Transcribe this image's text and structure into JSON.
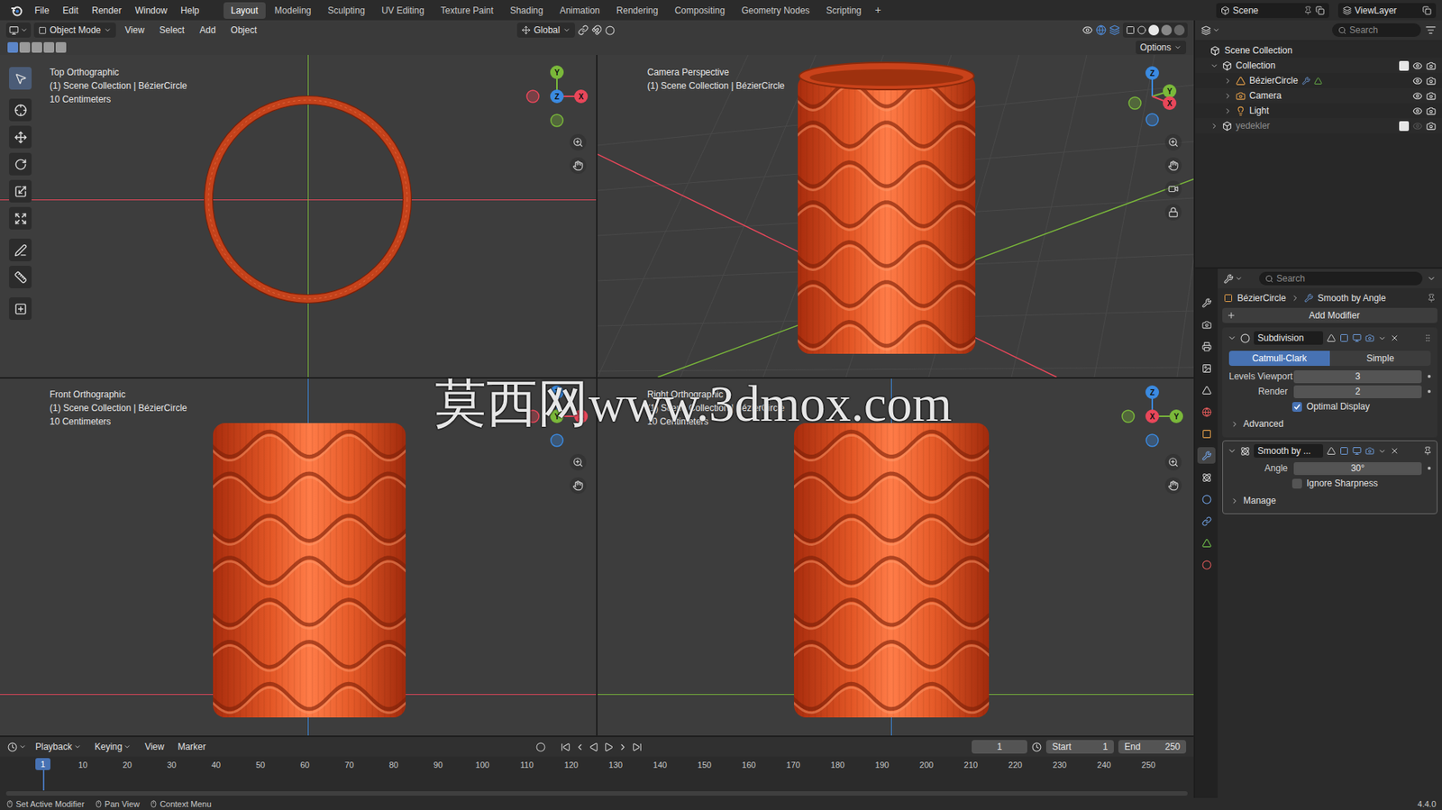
{
  "app": {
    "name": "Blender",
    "version": "4.4.0"
  },
  "menu_bar": {
    "items": [
      "File",
      "Edit",
      "Render",
      "Window",
      "Help"
    ]
  },
  "workspaces": [
    {
      "label": "Layout",
      "selected": true
    },
    {
      "label": "Modeling",
      "selected": false
    },
    {
      "label": "Sculpting",
      "selected": false
    },
    {
      "label": "UV Editing",
      "selected": false
    },
    {
      "label": "Texture Paint",
      "selected": false
    },
    {
      "label": "Shading",
      "selected": false
    },
    {
      "label": "Animation",
      "selected": false
    },
    {
      "label": "Rendering",
      "selected": false
    },
    {
      "label": "Compositing",
      "selected": false
    },
    {
      "label": "Geometry Nodes",
      "selected": false
    },
    {
      "label": "Scripting",
      "selected": false
    }
  ],
  "add_workspace": "+",
  "scene": "Scene",
  "view_layer": "ViewLayer",
  "viewport_header": {
    "mode": "Object Mode",
    "menus": [
      "View",
      "Select",
      "Add",
      "Object"
    ],
    "orientation": "Global",
    "options": "Options"
  },
  "toolbar": [
    {
      "selected": true
    },
    {
      "selected": false
    },
    {
      "selected": false
    },
    {
      "selected": false
    },
    {
      "selected": false
    },
    {
      "selected": false
    },
    {
      "selected": false
    },
    {
      "selected": false
    },
    {
      "selected": false
    }
  ],
  "viewports": [
    {
      "kind": "top",
      "title": "Top Orthographic",
      "context": "(1) Scene Collection | BézierCircle",
      "scale": "10 Centimeters",
      "gizmo": [
        {
          "label": "Y",
          "color": "#7ab83a"
        },
        {
          "label": "X",
          "color": "#e8475a"
        },
        {
          "label": "Z",
          "color": "#3b8ae0"
        }
      ]
    },
    {
      "kind": "camera",
      "title": "Camera Perspective",
      "context": "(1) Scene Collection | BézierCircle",
      "scale": "",
      "gizmo": [
        {
          "label": "Z",
          "color": "#3b8ae0"
        },
        {
          "label": "Y",
          "color": "#7ab83a"
        },
        {
          "label": "X",
          "color": "#e8475a"
        }
      ]
    },
    {
      "kind": "front",
      "title": "Front Orthographic",
      "context": "(1) Scene Collection | BézierCircle",
      "scale": "10 Centimeters",
      "gizmo": [
        {
          "label": "Z",
          "color": "#3b8ae0"
        },
        {
          "label": "X",
          "color": "#e8475a"
        },
        {
          "label": "Y",
          "color": "#7ab83a"
        }
      ]
    },
    {
      "kind": "right",
      "title": "Right Orthographic",
      "context": "(1) Scene Collection | BézierCircle",
      "scale": "10 Centimeters",
      "gizmo": [
        {
          "label": "Z",
          "color": "#3b8ae0"
        },
        {
          "label": "Y",
          "color": "#7ab83a"
        },
        {
          "label": "X",
          "color": "#e8475a"
        }
      ]
    }
  ],
  "watermark": "莫西网www.3dmox.com",
  "outliner": {
    "search_placeholder": "Search",
    "root": "Scene Collection",
    "items": [
      {
        "name": "Collection",
        "kind": "collection",
        "depth": 0,
        "expanded": true,
        "checked": true,
        "visible": true
      },
      {
        "name": "BézierCircle",
        "kind": "curve",
        "depth": 1,
        "expanded": false,
        "checked": false,
        "visible": true
      },
      {
        "name": "Camera",
        "kind": "camera",
        "depth": 1,
        "expanded": false,
        "checked": false,
        "visible": true
      },
      {
        "name": "Light",
        "kind": "light",
        "depth": 1,
        "expanded": false,
        "checked": false,
        "visible": true
      },
      {
        "name": "yedekler",
        "kind": "collection",
        "depth": 0,
        "expanded": false,
        "checked": true,
        "visible": false
      }
    ]
  },
  "property_tabs": [
    {
      "selected": false
    },
    {
      "selected": false
    },
    {
      "selected": false
    },
    {
      "selected": false
    },
    {
      "selected": false
    },
    {
      "selected": false
    },
    {
      "selected": false
    },
    {
      "selected": true
    },
    {
      "selected": false
    },
    {
      "selected": false
    },
    {
      "selected": false
    },
    {
      "selected": false
    },
    {
      "selected": false
    }
  ],
  "properties": {
    "search_placeholder": "Search",
    "breadcrumb": [
      "BézierCircle",
      "Smooth by Angle"
    ],
    "add_modifier": "Add Modifier",
    "modifiers": [
      {
        "kind": "subdivision",
        "name": "Subdivision",
        "expanded": true,
        "active": false,
        "methods": [
          {
            "label": "Catmull-Clark",
            "selected": true
          },
          {
            "label": "Simple",
            "selected": false
          }
        ],
        "fields": [
          {
            "label": "Levels Viewport",
            "value": "3"
          },
          {
            "label": "Render",
            "value": "2"
          }
        ],
        "checkboxes": [
          {
            "label": "Optimal Display",
            "checked": true
          }
        ],
        "subpanels": [
          {
            "label": "Advanced",
            "expanded": false
          }
        ]
      },
      {
        "kind": "smooth",
        "name": "Smooth by ...",
        "expanded": true,
        "active": true,
        "methods": [],
        "fields": [
          {
            "label": "Angle",
            "value": "30°"
          }
        ],
        "checkboxes": [
          {
            "label": "Ignore Sharpness",
            "checked": false
          }
        ],
        "subpanels": [
          {
            "label": "Manage",
            "expanded": false
          }
        ]
      }
    ]
  },
  "timeline": {
    "menus": [
      "Playback",
      "Keying",
      "View",
      "Marker"
    ],
    "current_frame": "1",
    "start_label": "Start",
    "start": "1",
    "end_label": "End",
    "end": "250",
    "ticks": [
      {
        "label": "1",
        "selected": true
      },
      {
        "label": "10",
        "selected": false
      },
      {
        "label": "20",
        "selected": false
      },
      {
        "label": "30",
        "selected": false
      },
      {
        "label": "40",
        "selected": false
      },
      {
        "label": "50",
        "selected": false
      },
      {
        "label": "60",
        "selected": false
      },
      {
        "label": "70",
        "selected": false
      },
      {
        "label": "80",
        "selected": false
      },
      {
        "label": "90",
        "selected": false
      },
      {
        "label": "100",
        "selected": false
      },
      {
        "label": "110",
        "selected": false
      },
      {
        "label": "120",
        "selected": false
      },
      {
        "label": "130",
        "selected": false
      },
      {
        "label": "140",
        "selected": false
      },
      {
        "label": "150",
        "selected": false
      },
      {
        "label": "160",
        "selected": false
      },
      {
        "label": "170",
        "selected": false
      },
      {
        "label": "180",
        "selected": false
      },
      {
        "label": "190",
        "selected": false
      },
      {
        "label": "200",
        "selected": false
      },
      {
        "label": "210",
        "selected": false
      },
      {
        "label": "220",
        "selected": false
      },
      {
        "label": "230",
        "selected": false
      },
      {
        "label": "240",
        "selected": false
      },
      {
        "label": "250",
        "selected": false
      }
    ]
  },
  "status_bar": {
    "items": [
      "Set Active Modifier",
      "Pan View",
      "Context Menu"
    ],
    "version": "4.4.0"
  }
}
